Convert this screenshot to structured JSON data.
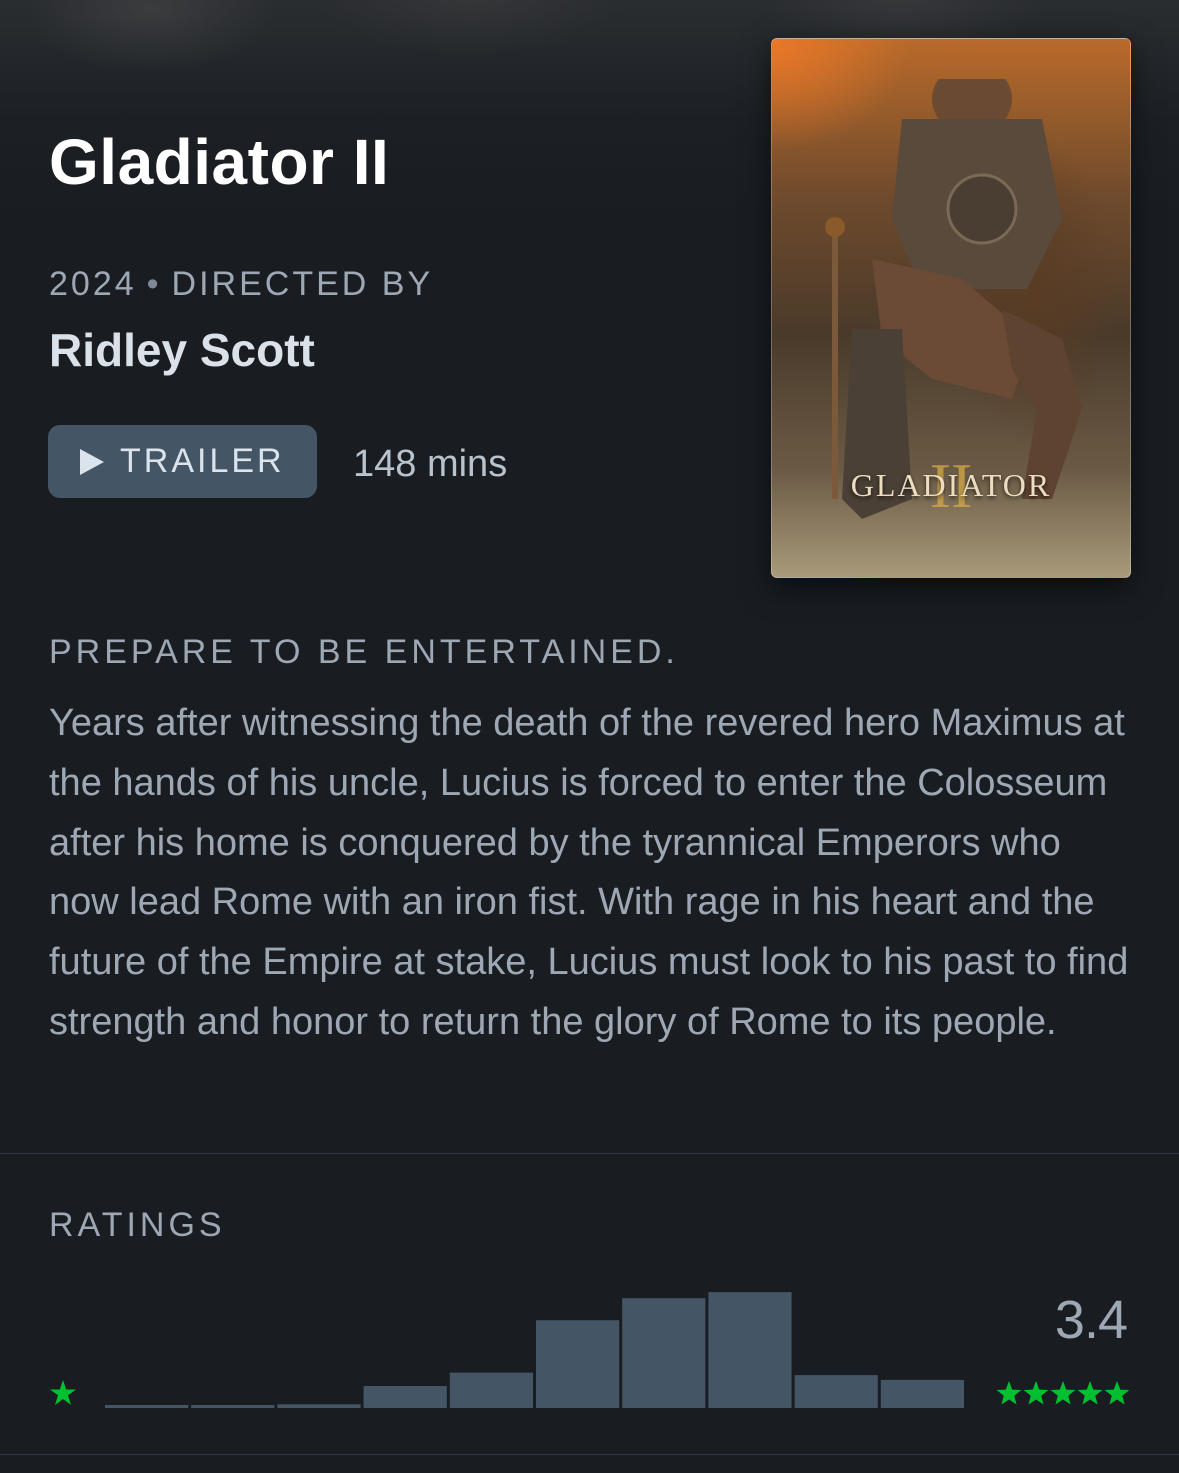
{
  "film": {
    "title": "Gladiator II",
    "year": "2024",
    "separator": "•",
    "directed_by_label": "DIRECTED BY",
    "director": "Ridley Scott",
    "runtime": "148 mins",
    "trailer_label": "TRAILER",
    "tagline": "PREPARE TO BE ENTERTAINED.",
    "synopsis": "Years after witnessing the death of the revered hero Maximus at the hands of his uncle, Lucius is forced to enter the Colosseum after his home is conquered by the tyrannical Emperors who now lead Rome with an iron fist. With rage in his heart and the future of the Empire at stake, Lucius must look to his past to find strength and honor to return the glory of Rome to its people."
  },
  "poster": {
    "title_text": "GLADIATOR",
    "numeral": "II"
  },
  "ratings": {
    "label": "RATINGS",
    "average": "3.4",
    "star_color": "#00c030",
    "bar_color": "#445566"
  },
  "chart_data": {
    "type": "bar",
    "categories": [
      "0.5",
      "1",
      "1.5",
      "2",
      "2.5",
      "3",
      "3.5",
      "4",
      "4.5",
      "5"
    ],
    "values": [
      2,
      2,
      3,
      18,
      29,
      72,
      90,
      95,
      27,
      23
    ],
    "ylim": [
      0,
      100
    ]
  },
  "icons": {
    "play": "play-icon",
    "star": "star-icon"
  }
}
